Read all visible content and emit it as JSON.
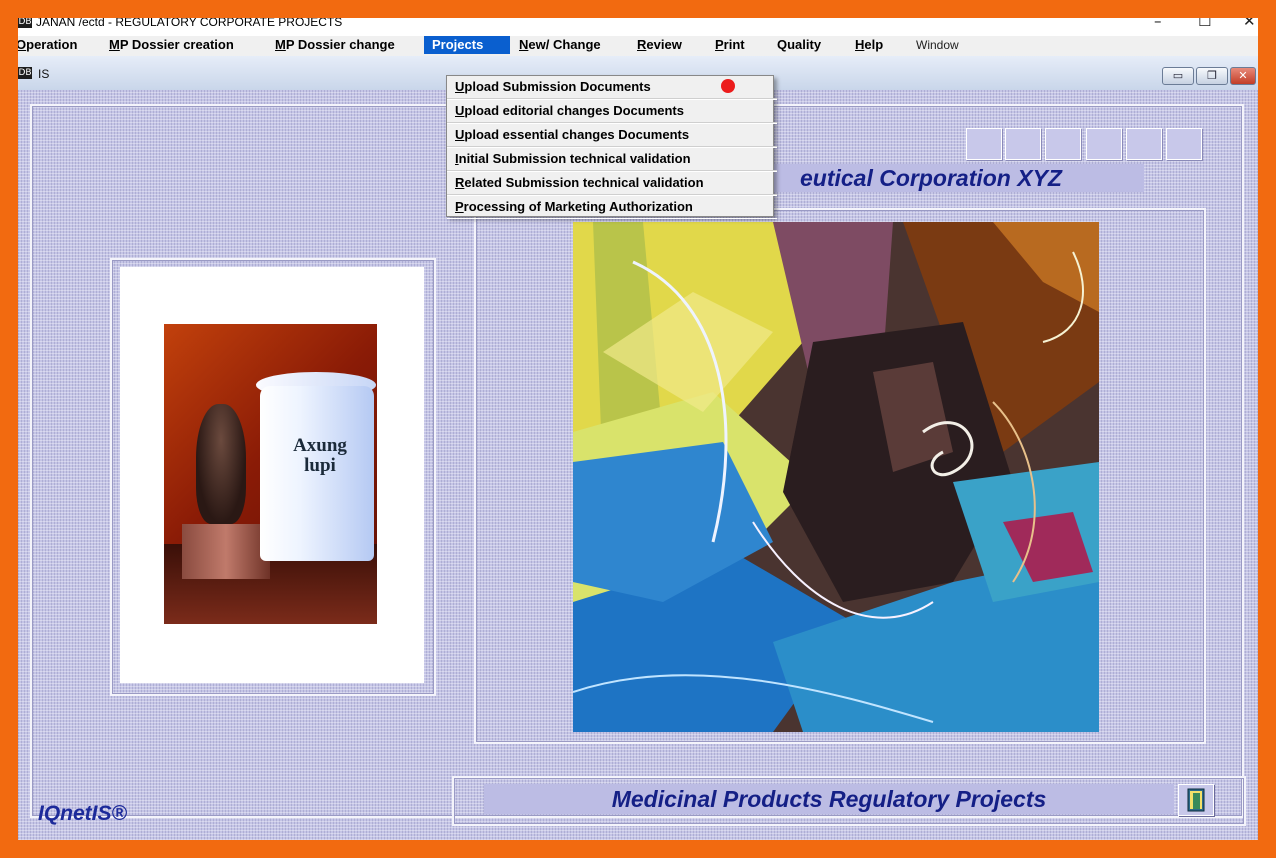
{
  "window": {
    "title": "JANAN /ectd - REGULATORY CORPORATE PROJECTS",
    "app_icon": "DB",
    "controls": {
      "minimize": "–",
      "maximize": "☐",
      "close": "✕"
    }
  },
  "menubar": {
    "items": [
      {
        "first": "O",
        "rest": "peration"
      },
      {
        "first": "M",
        "rest": "P Dossier creation"
      },
      {
        "first": "M",
        "rest": "P Dossier change"
      },
      {
        "first": "",
        "rest": "Projects"
      },
      {
        "first": "N",
        "rest": "ew/ Change"
      },
      {
        "first": "R",
        "rest": "eview"
      },
      {
        "first": "P",
        "rest": "rint"
      },
      {
        "first": "",
        "rest": "Quality"
      },
      {
        "first": "H",
        "rest": "elp"
      },
      {
        "first": "",
        "rest": "Window"
      }
    ],
    "active_index": 3
  },
  "projects_menu": {
    "items": [
      {
        "first": "U",
        "rest": "pload Submission Documents"
      },
      {
        "first": "U",
        "rest": "pload editorial changes Documents"
      },
      {
        "first": "U",
        "rest": "pload essential changes Documents"
      },
      {
        "first": "I",
        "rest": "nitial Submission technical validation"
      },
      {
        "first": "R",
        "rest": "elated Submission technical validation"
      },
      {
        "first": "P",
        "rest": "rocessing of Marketing Authorization"
      }
    ],
    "cursor_marker_color": "#ec1c1c"
  },
  "mdi": {
    "doc_icon": "DB",
    "doc_title": "IS",
    "controls": {
      "minimize": "▭",
      "restore": "❐",
      "close": "✕"
    }
  },
  "main": {
    "corporation_banner": "eutical Corporation XYZ",
    "jar_label": "Axung\nlupi",
    "logo": "IQnetIS®",
    "bottom_banner": "Medicinal Products Regulatory Projects"
  },
  "colors": {
    "desktop": "#f26a10",
    "menu_highlight": "#0a5fcf",
    "banner_text": "#141f86",
    "client_bg": "#c5c5e6"
  },
  "icons": [
    "app-icon",
    "doc-icon",
    "exit-door-icon"
  ]
}
